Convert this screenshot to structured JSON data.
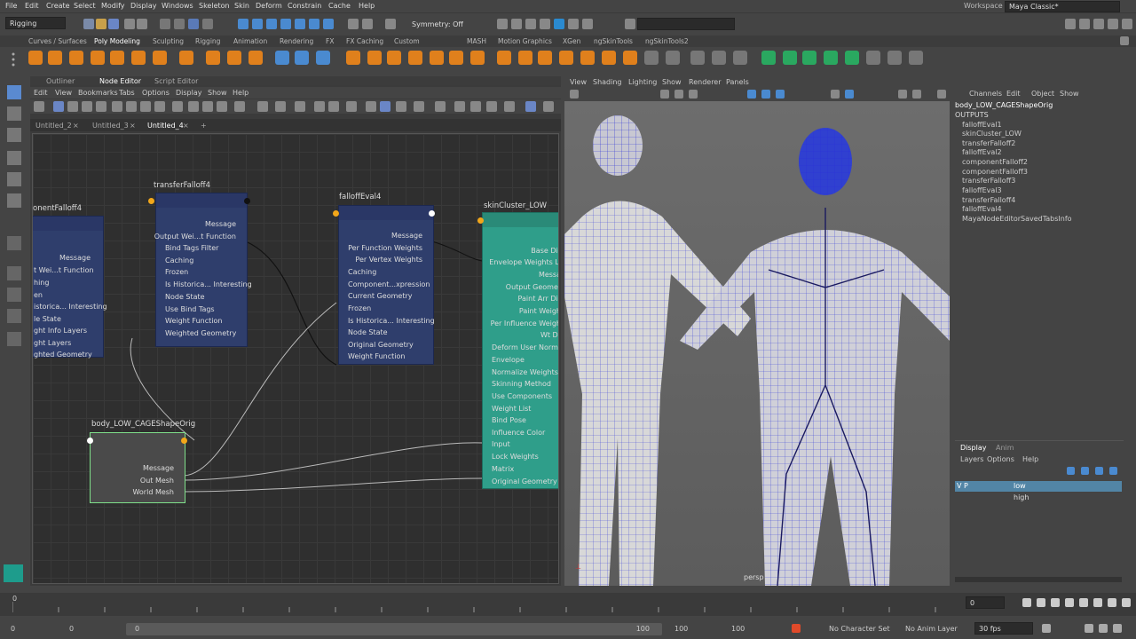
{
  "menubar": {
    "items": [
      "File",
      "Edit",
      "Create",
      "Select",
      "Modify",
      "Display",
      "Windows",
      "Skeleton",
      "Skin",
      "Deform",
      "Constrain",
      "Cache",
      "Help"
    ],
    "workspace_label": "Workspace :",
    "workspace_value": "Maya Classic*"
  },
  "toolbar": {
    "mode": "Rigging",
    "symmetry": "Symmetry: Off"
  },
  "shelf_tabs": [
    "Curves / Surfaces",
    "Poly Modeling",
    "Sculpting",
    "Rigging",
    "Animation",
    "Rendering",
    "FX",
    "FX Caching",
    "Custom",
    "MASH",
    "Motion Graphics",
    "XGen",
    "ngSkinTools",
    "ngSkinTools2"
  ],
  "panel_tabs": {
    "outliner": "Outliner",
    "node_editor": "Node Editor",
    "script_editor": "Script Editor"
  },
  "node_editor": {
    "menu": [
      "Edit",
      "View",
      "Bookmarks",
      "Tabs",
      "Options",
      "Display",
      "Show",
      "Help"
    ],
    "tabs": [
      "Untitled_2",
      "Untitled_3",
      "Untitled_4"
    ],
    "add_tab": "+",
    "nodes": {
      "n1": {
        "title": "onentFalloff4",
        "attrs": [
          "Message",
          "t Wei...t Function",
          "hing",
          "en",
          "istorica... Interesting",
          "le State",
          "ght Info Layers",
          "ght Layers",
          "ghted Geometry"
        ]
      },
      "n2": {
        "title": "transferFalloff4",
        "attrs": [
          "Message",
          "Output Wei...t Function",
          "Bind Tags Filter",
          "Caching",
          "Frozen",
          "Is Historica... Interesting",
          "Node State",
          "Use Bind Tags",
          "Weight Function",
          "Weighted Geometry"
        ]
      },
      "n3": {
        "title": "falloffEval4",
        "attrs": [
          "Message",
          "Per Function Weights",
          "Per Vertex Weights",
          "Caching",
          "Component...xpression",
          "Current Geometry",
          "Frozen",
          "Is Historica... Interesting",
          "Node State",
          "Original Geometry",
          "Weight Function"
        ]
      },
      "n4": {
        "title": "skinCluster_LOW",
        "attrs": [
          "Base Dir",
          "Envelope Weights Li",
          "Messa",
          "Output Geomet",
          "Paint Arr Dir",
          "Paint Weigh",
          "Per Influence Weigh",
          "Wt Dr",
          "Deform User Norma",
          "Envelope",
          "Normalize Weights",
          "Skinning Method",
          "Use Components",
          "Weight List",
          "Bind Pose",
          "Influence Color",
          "Input",
          "Lock Weights",
          "Matrix",
          "Original Geometry"
        ]
      },
      "n5": {
        "title": "body_LOW_CAGEShapeOrig",
        "attrs": [
          "Message",
          "Out Mesh",
          "World Mesh"
        ]
      }
    }
  },
  "viewport": {
    "menu": [
      "View",
      "Shading",
      "Lighting",
      "Show",
      "Renderer",
      "Panels"
    ],
    "camera": "persp"
  },
  "channel_box": {
    "menu": [
      "Channels",
      "Edit",
      "Object",
      "Show"
    ],
    "object": "body_LOW_CAGEShapeOrig",
    "section": "OUTPUTS",
    "outputs": [
      "falloffEval1",
      "skinCluster_LOW",
      "transferFalloff2",
      "falloffEval2",
      "componentFalloff2",
      "componentFalloff3",
      "transferFalloff3",
      "falloffEval3",
      "transferFalloff4",
      "falloffEval4",
      "MayaNodeEditorSavedTabsInfo"
    ],
    "layer_tabs": [
      "Display",
      "Anim"
    ],
    "layer_menu": [
      "Layers",
      "Options",
      "Help"
    ],
    "layers": [
      {
        "name": "low",
        "flags": "V P"
      },
      {
        "name": "high",
        "flags": ""
      }
    ]
  },
  "timeline": {
    "start": "0",
    "current": "0"
  },
  "range": {
    "start": "0",
    "start2": "0",
    "range_start": "0",
    "range_end": "100",
    "end": "100",
    "end2": "100",
    "character_set": "No Character Set",
    "anim_layer": "No Anim Layer",
    "fps": "30 fps"
  },
  "colors": {
    "node_blue": "#2f3e6c",
    "node_teal": "#2f9e8a",
    "mesh_wire": "#2a2fd6",
    "selected_green": "#7fe08a"
  }
}
